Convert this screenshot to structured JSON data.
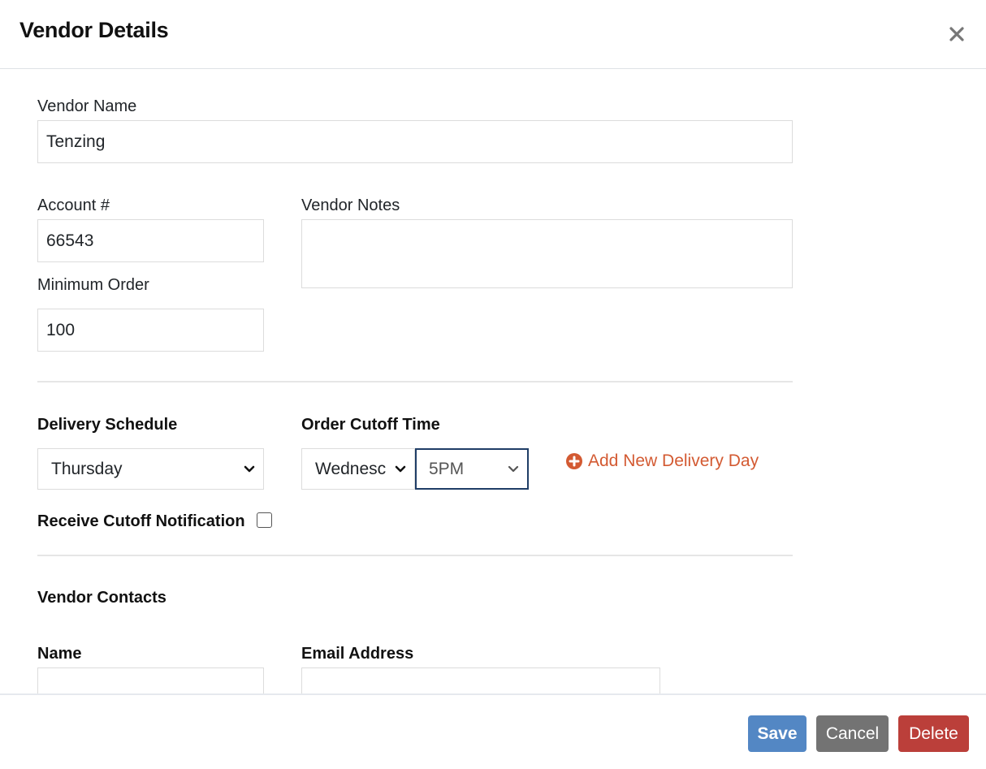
{
  "header": {
    "title": "Vendor Details",
    "close_icon": "close-icon"
  },
  "form": {
    "vendor_name": {
      "label": "Vendor Name",
      "value": "Tenzing"
    },
    "account": {
      "label": "Account #",
      "value": "66543"
    },
    "vendor_notes": {
      "label": "Vendor Notes",
      "value": ""
    },
    "minimum_order": {
      "label": "Minimum Order",
      "value": "100"
    },
    "delivery_schedule": {
      "label": "Delivery Schedule",
      "selected": "Thursday"
    },
    "order_cutoff": {
      "label": "Order Cutoff Time",
      "day_selected": "Wednesday",
      "day_visible": "Wednesc",
      "time_selected": "5PM"
    },
    "add_delivery_day": {
      "label": "Add New Delivery Day",
      "icon": "plus-circle-icon",
      "color": "#d35a32"
    },
    "receive_cutoff_notification": {
      "label": "Receive Cutoff Notification",
      "checked": false
    },
    "vendor_contacts": {
      "heading": "Vendor Contacts",
      "name_label": "Name",
      "email_label": "Email Address",
      "name_value": "",
      "email_value": ""
    }
  },
  "footer": {
    "save_label": "Save",
    "cancel_label": "Cancel",
    "delete_label": "Delete"
  },
  "colors": {
    "save": "#5387c4",
    "cancel": "#737373",
    "delete": "#bb3f3a",
    "accent": "#d35a32",
    "focus_border": "#1f3d66"
  }
}
